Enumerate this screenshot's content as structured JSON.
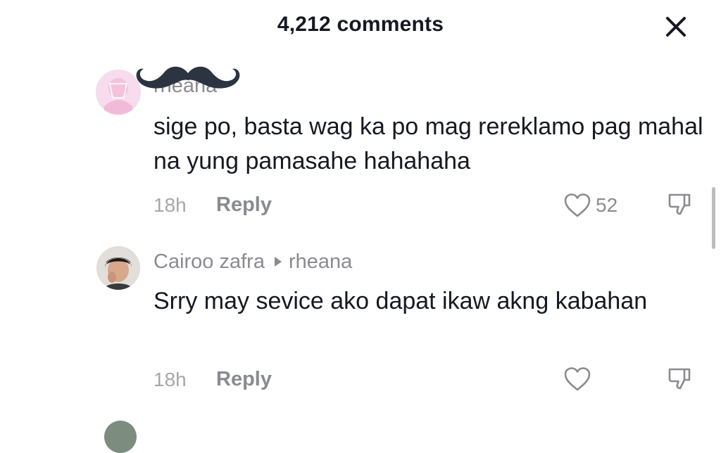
{
  "header": {
    "title": "4,212 comments",
    "close_icon": "close-icon"
  },
  "comments": [
    {
      "username": "rheana",
      "username_obscured": true,
      "text": "sige po, basta wag ka po mag rereklamo pag mahal na yung pamasahe hahahaha",
      "time": "18h",
      "reply_label": "Reply",
      "like_count": "52",
      "avatar_color": "#f7dfee"
    },
    {
      "username": "Cairoo zafra",
      "reply_to": "rheana",
      "text": "Srry may sevice ako dapat ikaw akng kabahan",
      "time": "18h",
      "reply_label": "Reply",
      "avatar_color": "#d9d6d2"
    }
  ],
  "icons": {
    "like": "heart-outline-icon",
    "dislike": "thumbs-down-icon",
    "reply_arrow": "reply-triangle-icon",
    "close": "close-icon"
  },
  "colors": {
    "text_primary": "#161823",
    "text_secondary": "#8a8b91",
    "text_muted": "#a6a7ab"
  }
}
